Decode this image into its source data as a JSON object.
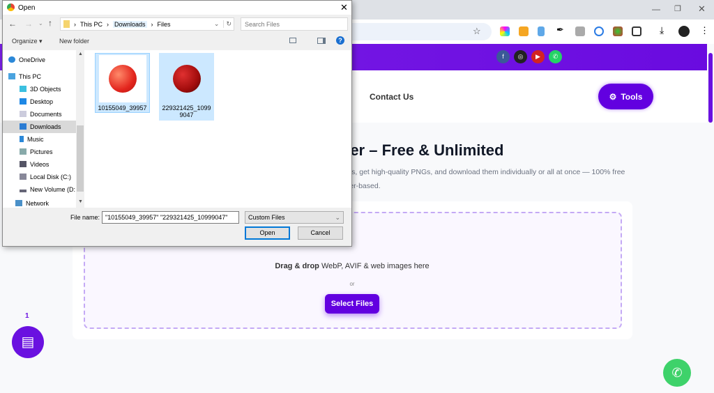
{
  "browser": {
    "window_controls": [
      "minimize",
      "restore",
      "close"
    ],
    "extensions": [
      "color-picker-ext",
      "seo-ext",
      "clipboard-ext",
      "eyedropper-ext",
      "code-ext",
      "copyright-ext",
      "globe-ext",
      "puzzle-icon"
    ]
  },
  "site": {
    "social": [
      "facebook",
      "instagram",
      "youtube",
      "whatsapp"
    ],
    "nav": {
      "contact": "Contact Us",
      "tools": "Tools"
    },
    "hero": {
      "title": "ter – Free & Unlimited",
      "sub1": "les, get high-quality PNGs, and download them individually or all at once — 100% free",
      "sub2": "ser-based."
    },
    "dropzone": {
      "bold": "Drag & drop",
      "text": " WebP, AVIF & web images here",
      "or": "or",
      "button": "Select Files"
    },
    "chat_badge": "1"
  },
  "dialog": {
    "title": "Open",
    "breadcrumb": [
      "This PC",
      "Downloads",
      "Files"
    ],
    "search_placeholder": "Search Files",
    "organize": "Organize ▾",
    "new_folder": "New folder",
    "nav_items": [
      {
        "label": "OneDrive",
        "color": "#2b88d8"
      },
      {
        "label": "This PC",
        "color": "#4aa3df"
      },
      {
        "label": "3D Objects",
        "color": "#3cc0e0"
      },
      {
        "label": "Desktop",
        "color": "#1e88e5"
      },
      {
        "label": "Documents",
        "color": "#9aa"
      },
      {
        "label": "Downloads",
        "color": "#2b7cd3"
      },
      {
        "label": "Music",
        "color": "#2b88d8"
      },
      {
        "label": "Pictures",
        "color": "#8aa"
      },
      {
        "label": "Videos",
        "color": "#556"
      },
      {
        "label": "Local Disk (C:)",
        "color": "#778"
      },
      {
        "label": "New Volume (D:)",
        "color": "#667"
      },
      {
        "label": "Network",
        "color": "#4a90c8"
      }
    ],
    "selected_nav": "Downloads",
    "files": [
      {
        "name": "10155049_39957"
      },
      {
        "name": "229321425_10999047"
      }
    ],
    "file_name_label": "File name:",
    "file_name_value": "\"10155049_39957\" \"229321425_10999047\"",
    "file_type": "Custom Files",
    "open": "Open",
    "cancel": "Cancel"
  }
}
